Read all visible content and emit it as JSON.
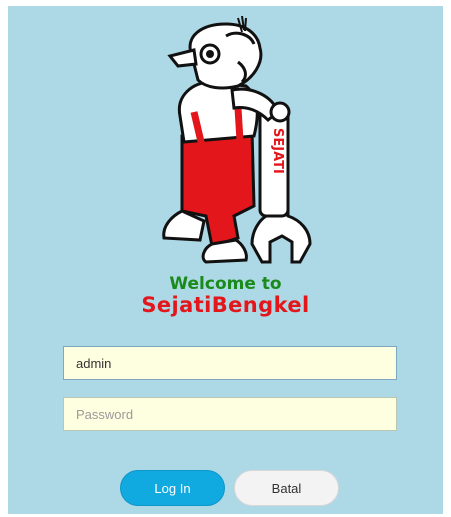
{
  "header": {
    "welcome": "Welcome to",
    "brand": "SejatiBengkel",
    "logo_text": "SEJATI"
  },
  "form": {
    "username_value": "admin",
    "password_placeholder": "Password",
    "login_label": "Log In",
    "cancel_label": "Batal"
  },
  "colors": {
    "background": "#add8e6",
    "welcome": "#1a8a1a",
    "brand": "#e3161b",
    "login_button": "#10a9e0",
    "input_background": "#fefee0"
  }
}
